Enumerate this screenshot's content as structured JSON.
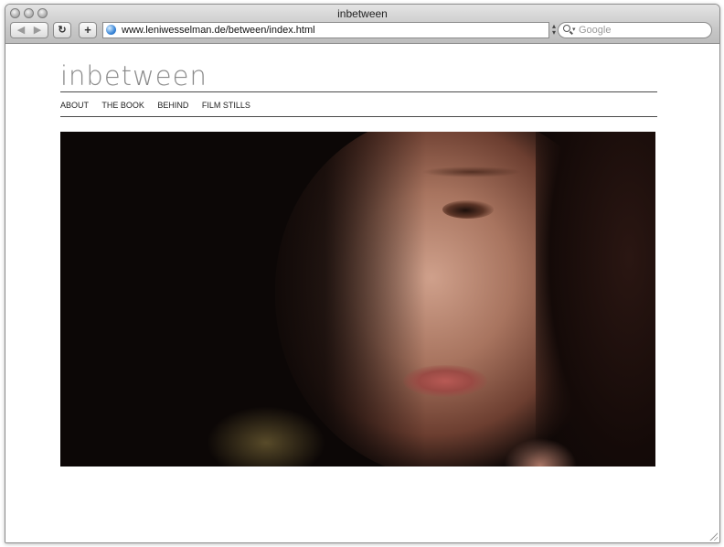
{
  "window": {
    "title": "inbetween"
  },
  "toolbar": {
    "back_icon": "back-arrow-icon",
    "forward_icon": "forward-arrow-icon",
    "reload_icon": "reload-icon",
    "add_bookmark_label": "+",
    "url": "www.leniwesselman.de/between/index.html",
    "search_placeholder": "Google"
  },
  "site": {
    "title": "inbetween",
    "nav": [
      {
        "label": "ABOUT"
      },
      {
        "label": "THE BOOK"
      },
      {
        "label": "BEHIND"
      },
      {
        "label": "FILM STILLS"
      }
    ]
  }
}
